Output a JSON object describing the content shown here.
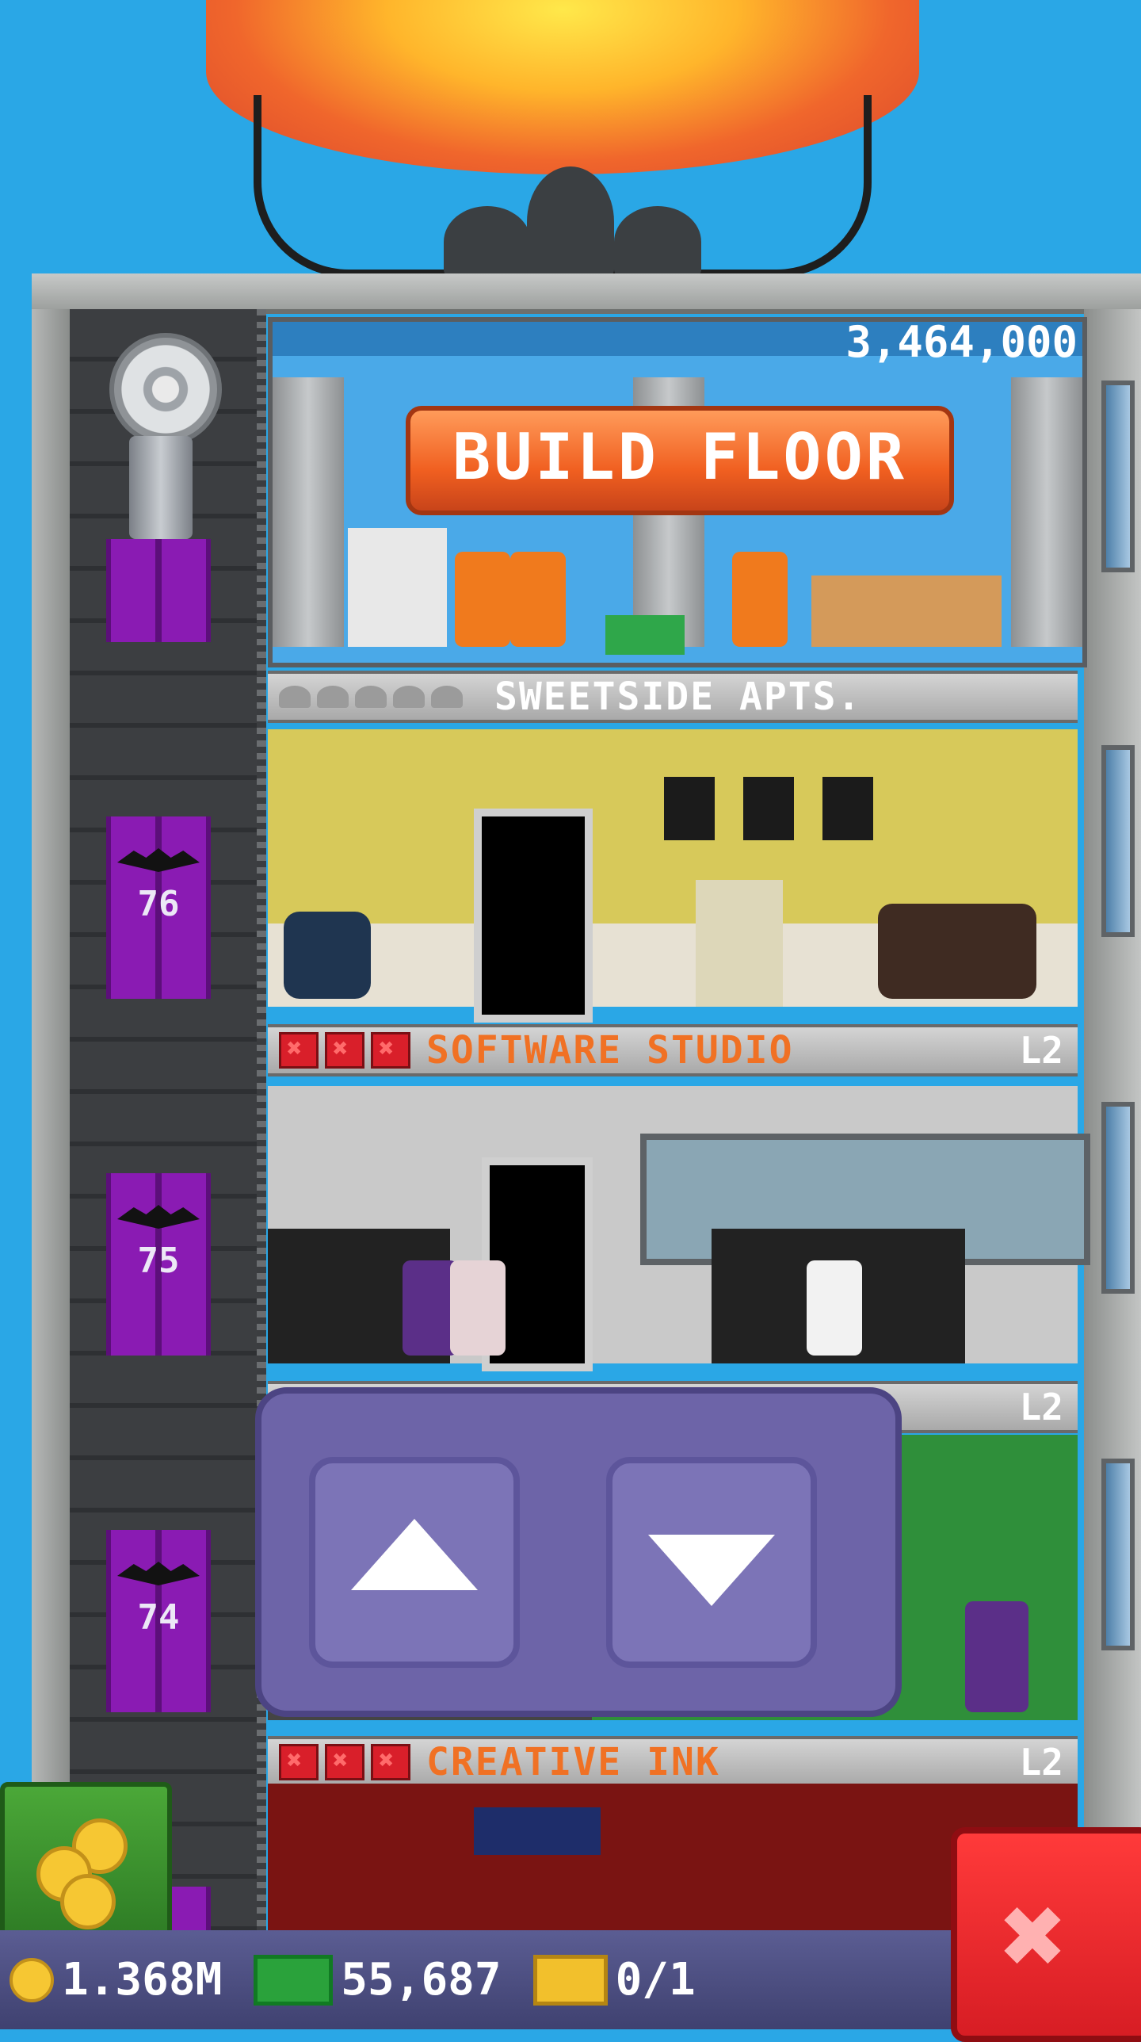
{
  "build_floor": {
    "price": "3,464,000",
    "label": "BUILD FLOOR"
  },
  "floors": [
    {
      "name": "SWEETSIDE APTS.",
      "type": "residential"
    },
    {
      "name": "SOFTWARE STUDIO",
      "level": "L2"
    },
    {
      "name": "",
      "level": "L2"
    },
    {
      "name": "CREATIVE INK",
      "level": "L2"
    }
  ],
  "elevator": {
    "floor_numbers": [
      "76",
      "75",
      "74"
    ]
  },
  "bottom_bar": {
    "coins": "1.368M",
    "bux": "55,687",
    "tickets": "0/1"
  },
  "icons": {
    "coin": "coin-icon",
    "bux": "cash-icon",
    "ticket": "ticket-icon",
    "close": "close-icon",
    "up": "arrow-up-icon",
    "down": "arrow-down-icon"
  }
}
